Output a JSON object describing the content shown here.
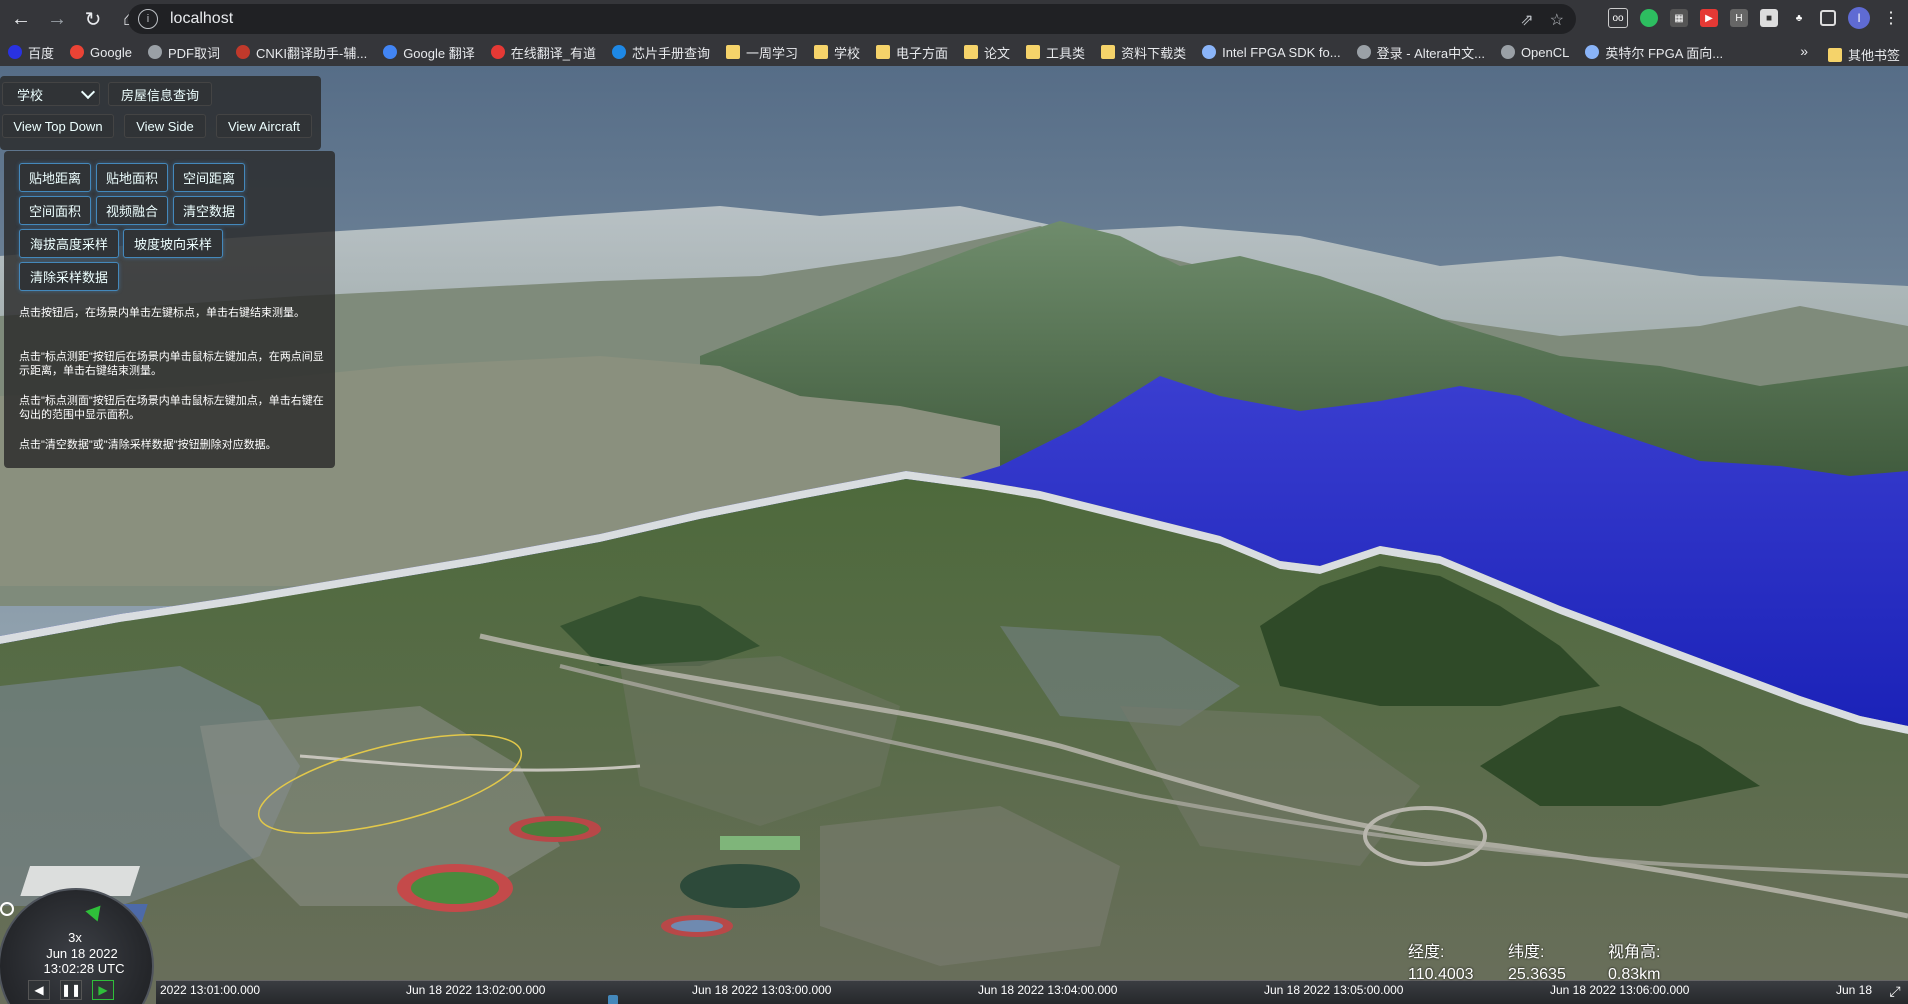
{
  "browser": {
    "url": "localhost",
    "bookmarks": [
      {
        "label": "百度",
        "icon": "baidu-icon",
        "color": "#2932e1"
      },
      {
        "label": "Google",
        "icon": "google-icon",
        "color": "#ea4335"
      },
      {
        "label": "PDF取词",
        "icon": "globe-icon",
        "color": "#9aa0a6"
      },
      {
        "label": "CNKI翻译助手-辅...",
        "icon": "cnki-icon",
        "color": "#c0392b"
      },
      {
        "label": "Google 翻译",
        "icon": "google-translate-icon",
        "color": "#4285f4"
      },
      {
        "label": "在线翻译_有道",
        "icon": "youdao-icon",
        "color": "#e53935"
      },
      {
        "label": "芯片手册查询",
        "icon": "chip-icon",
        "color": "#1e88e5"
      },
      {
        "label": "一周学习",
        "icon": "folder-icon",
        "color": "#f5d36a"
      },
      {
        "label": "学校",
        "icon": "folder-icon",
        "color": "#f5d36a"
      },
      {
        "label": "电子方面",
        "icon": "folder-icon",
        "color": "#f5d36a"
      },
      {
        "label": "论文",
        "icon": "folder-icon",
        "color": "#f5d36a"
      },
      {
        "label": "工具类",
        "icon": "folder-icon",
        "color": "#f5d36a"
      },
      {
        "label": "资料下载类",
        "icon": "folder-icon",
        "color": "#f5d36a"
      },
      {
        "label": "Intel FPGA SDK fo...",
        "icon": "intel-icon",
        "color": "#8ab4f8"
      },
      {
        "label": "登录 - Altera中文...",
        "icon": "globe-icon",
        "color": "#9aa0a6"
      },
      {
        "label": "OpenCL",
        "icon": "globe-icon",
        "color": "#9aa0a6"
      },
      {
        "label": "英特尔 FPGA 面向...",
        "icon": "intel-a-icon",
        "color": "#8ab4f8"
      }
    ],
    "more_label": "»",
    "other_bookmarks": "其他书签",
    "avatar_letter": "I"
  },
  "controls": {
    "select_value": "学校",
    "house_query": "房屋信息查询",
    "view_top_down": "View Top Down",
    "view_side": "View Side",
    "view_aircraft": "View Aircraft"
  },
  "tools": {
    "buttons": [
      "贴地距离",
      "贴地面积",
      "空间距离",
      "空间面积",
      "视频融合",
      "清空数据",
      "海拔高度采样",
      "坡度坡向采样",
      "清除采样数据"
    ],
    "hints": [
      "点击按钮后，在场景内单击左键标点，单击右键结束测量。",
      "点击\"标点测距\"按钮后在场景内单击鼠标左键加点，在两点间显示距离，单击右键结束测量。",
      "点击\"标点测面\"按钮后在场景内单击鼠标左键加点，单击右键在勾出的范围中显示面积。",
      "点击\"清空数据\"或\"清除采样数据\"按钮删除对应数据。"
    ]
  },
  "clock": {
    "speed": "3x",
    "date": "Jun 18 2022",
    "time": "13:02:28 UTC"
  },
  "timeline": {
    "labels": [
      "2022 13:01:00.000",
      "Jun 18 2022 13:02:00.000",
      "Jun 18 2022 13:03:00.000",
      "Jun 18 2022 13:04:00.000",
      "Jun 18 2022 13:05:00.000",
      "Jun 18 2022 13:06:00.000",
      "Jun 18"
    ]
  },
  "coords": {
    "lon_label": "经度:",
    "lon_value": "110.4003",
    "lat_label": "纬度:",
    "lat_value": "25.3635",
    "height_label": "视角高:",
    "height_value": "0.83km"
  }
}
